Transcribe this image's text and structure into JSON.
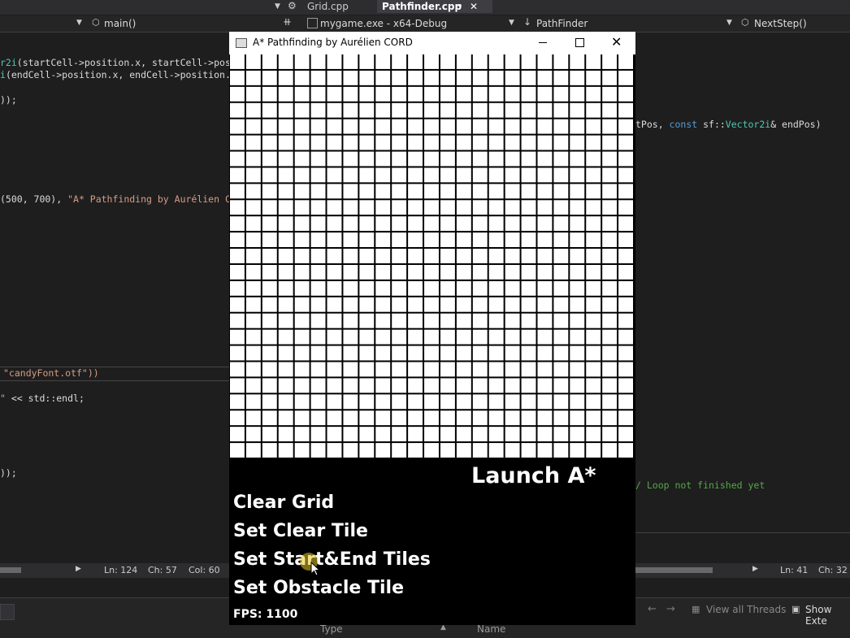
{
  "ide": {
    "tabs": [
      "Grid.cpp",
      "Pathfinder.cpp"
    ],
    "left_nav": "main()",
    "target": "mygame.exe - x64-Debug",
    "class_nav": "PathFinder",
    "method_nav": "NextStep()",
    "code_left": {
      "l1a": "r2i",
      "l1b": "(startCell->position.x, startCell->posi",
      "l2a": "i",
      "l2b": "(endCell->position.x, endCell->position.y",
      "l3": "));",
      "l4a": "(500, 700), ",
      "l4b": "\"A* Pathfinding by Aurélien CO",
      "l5": "\"candyFont.otf\"))",
      "l6a": "\" ",
      "l6b": "<< std::endl;",
      "l7": "));"
    },
    "code_right": {
      "r1a": "tPos, ",
      "r1b": "const",
      "r1c": " sf::",
      "r1d": "Vector2i",
      "r1e": "& endPos)",
      "r2": "/ Loop not finished yet"
    },
    "status_left": {
      "ln": "Ln: 124",
      "ch": "Ch: 57",
      "col": "Col: 60"
    },
    "status_right": {
      "ln": "Ln: 41",
      "ch": "Ch: 32"
    },
    "bottom": {
      "view_threads": "View all Threads",
      "show_ext": "Show Exte",
      "type_col": "Type",
      "name_col": "Name"
    }
  },
  "game": {
    "title": "A* Pathfinding by Aurélien CORD",
    "grid": {
      "rows": 25,
      "cols": 25
    },
    "launch": "Launch A*",
    "clear_grid": "Clear Grid",
    "set_clear": "Set Clear Tile",
    "set_start_end": "Set Start&End Tiles",
    "set_obstacle": "Set Obstacle Tile",
    "fps": "FPS: 1100"
  }
}
